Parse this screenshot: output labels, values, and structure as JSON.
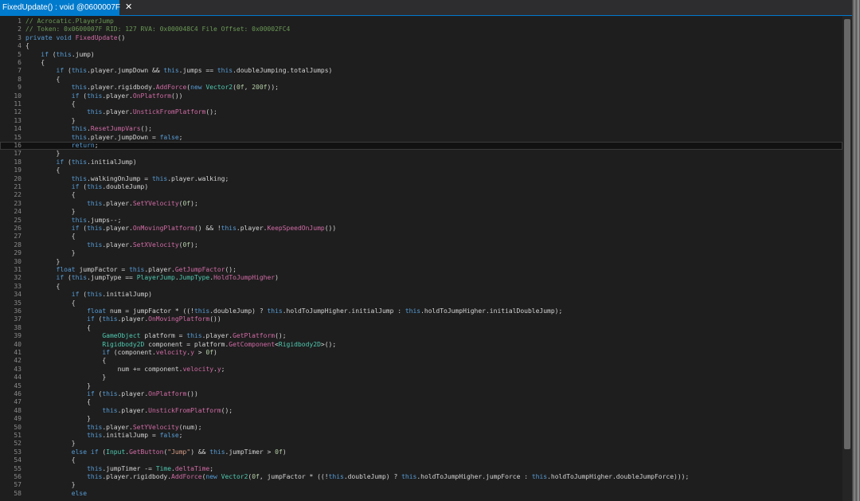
{
  "tab": {
    "title": "FixedUpdate() : void @0600007F",
    "close_glyph": "✕"
  },
  "colors": {
    "background": "#1e1e1e",
    "keyword": "#569cd6",
    "method": "#d16ba5",
    "type": "#4ec9b0",
    "comment": "#6a9955",
    "number": "#b5cea8",
    "string": "#d69d85",
    "text": "#d4d4d4",
    "line_number": "#8a8a8a",
    "tab_accent": "#007acc"
  },
  "current_line": 16,
  "lines": [
    [
      [
        "cm",
        "// Acrocatic.PlayerJump"
      ]
    ],
    [
      [
        "cm",
        "// Token: 0x0600007F RID: 127 RVA: 0x000048C4 File Offset: 0x00002FC4"
      ]
    ],
    [
      [
        "kw",
        "private"
      ],
      [
        "id",
        " "
      ],
      [
        "kw",
        "void"
      ],
      [
        "id",
        " "
      ],
      [
        "fn",
        "FixedUpdate"
      ],
      [
        "id",
        "()"
      ]
    ],
    [
      [
        "id",
        "{"
      ]
    ],
    [
      [
        "id",
        "    "
      ],
      [
        "kw",
        "if"
      ],
      [
        "id",
        " ("
      ],
      [
        "kw",
        "this"
      ],
      [
        "id",
        ".jump)"
      ]
    ],
    [
      [
        "id",
        "    {"
      ]
    ],
    [
      [
        "id",
        "        "
      ],
      [
        "kw",
        "if"
      ],
      [
        "id",
        " ("
      ],
      [
        "kw",
        "this"
      ],
      [
        "id",
        ".player.jumpDown && "
      ],
      [
        "kw",
        "this"
      ],
      [
        "id",
        ".jumps == "
      ],
      [
        "kw",
        "this"
      ],
      [
        "id",
        ".doubleJumping.totalJumps)"
      ]
    ],
    [
      [
        "id",
        "        {"
      ]
    ],
    [
      [
        "id",
        "            "
      ],
      [
        "kw",
        "this"
      ],
      [
        "id",
        ".player.rigidbody."
      ],
      [
        "fn",
        "AddForce"
      ],
      [
        "id",
        "("
      ],
      [
        "kw",
        "new"
      ],
      [
        "id",
        " "
      ],
      [
        "ty",
        "Vector2"
      ],
      [
        "id",
        "("
      ],
      [
        "nu",
        "0f"
      ],
      [
        "id",
        ", "
      ],
      [
        "nu",
        "200f"
      ],
      [
        "id",
        "));"
      ]
    ],
    [
      [
        "id",
        "            "
      ],
      [
        "kw",
        "if"
      ],
      [
        "id",
        " ("
      ],
      [
        "kw",
        "this"
      ],
      [
        "id",
        ".player."
      ],
      [
        "fn",
        "OnPlatform"
      ],
      [
        "id",
        "())"
      ]
    ],
    [
      [
        "id",
        "            {"
      ]
    ],
    [
      [
        "id",
        "                "
      ],
      [
        "kw",
        "this"
      ],
      [
        "id",
        ".player."
      ],
      [
        "fn",
        "UnstickFromPlatform"
      ],
      [
        "id",
        "();"
      ]
    ],
    [
      [
        "id",
        "            }"
      ]
    ],
    [
      [
        "id",
        "            "
      ],
      [
        "kw",
        "this"
      ],
      [
        "id",
        "."
      ],
      [
        "fn",
        "ResetJumpVars"
      ],
      [
        "id",
        "();"
      ]
    ],
    [
      [
        "id",
        "            "
      ],
      [
        "kw",
        "this"
      ],
      [
        "id",
        ".player.jumpDown = "
      ],
      [
        "kw",
        "false"
      ],
      [
        "id",
        ";"
      ]
    ],
    [
      [
        "id",
        "            "
      ],
      [
        "kw",
        "return"
      ],
      [
        "id",
        ";"
      ]
    ],
    [
      [
        "id",
        "        }"
      ]
    ],
    [
      [
        "id",
        "        "
      ],
      [
        "kw",
        "if"
      ],
      [
        "id",
        " ("
      ],
      [
        "kw",
        "this"
      ],
      [
        "id",
        ".initialJump)"
      ]
    ],
    [
      [
        "id",
        "        {"
      ]
    ],
    [
      [
        "id",
        "            "
      ],
      [
        "kw",
        "this"
      ],
      [
        "id",
        ".walkingOnJump = "
      ],
      [
        "kw",
        "this"
      ],
      [
        "id",
        ".player.walking;"
      ]
    ],
    [
      [
        "id",
        "            "
      ],
      [
        "kw",
        "if"
      ],
      [
        "id",
        " ("
      ],
      [
        "kw",
        "this"
      ],
      [
        "id",
        ".doubleJump)"
      ]
    ],
    [
      [
        "id",
        "            {"
      ]
    ],
    [
      [
        "id",
        "                "
      ],
      [
        "kw",
        "this"
      ],
      [
        "id",
        ".player."
      ],
      [
        "fn",
        "SetYVelocity"
      ],
      [
        "id",
        "("
      ],
      [
        "nu",
        "0f"
      ],
      [
        "id",
        ");"
      ]
    ],
    [
      [
        "id",
        "            }"
      ]
    ],
    [
      [
        "id",
        "            "
      ],
      [
        "kw",
        "this"
      ],
      [
        "id",
        ".jumps--;"
      ]
    ],
    [
      [
        "id",
        "            "
      ],
      [
        "kw",
        "if"
      ],
      [
        "id",
        " ("
      ],
      [
        "kw",
        "this"
      ],
      [
        "id",
        ".player."
      ],
      [
        "fn",
        "OnMovingPlatform"
      ],
      [
        "id",
        "() && !"
      ],
      [
        "kw",
        "this"
      ],
      [
        "id",
        ".player."
      ],
      [
        "fn",
        "KeepSpeedOnJump"
      ],
      [
        "id",
        "())"
      ]
    ],
    [
      [
        "id",
        "            {"
      ]
    ],
    [
      [
        "id",
        "                "
      ],
      [
        "kw",
        "this"
      ],
      [
        "id",
        ".player."
      ],
      [
        "fn",
        "SetXVelocity"
      ],
      [
        "id",
        "("
      ],
      [
        "nu",
        "0f"
      ],
      [
        "id",
        ");"
      ]
    ],
    [
      [
        "id",
        "            }"
      ]
    ],
    [
      [
        "id",
        "        }"
      ]
    ],
    [
      [
        "id",
        "        "
      ],
      [
        "kw",
        "float"
      ],
      [
        "id",
        " jumpFactor = "
      ],
      [
        "kw",
        "this"
      ],
      [
        "id",
        ".player."
      ],
      [
        "fn",
        "GetJumpFactor"
      ],
      [
        "id",
        "();"
      ]
    ],
    [
      [
        "id",
        "        "
      ],
      [
        "kw",
        "if"
      ],
      [
        "id",
        " ("
      ],
      [
        "kw",
        "this"
      ],
      [
        "id",
        ".jumpType == "
      ],
      [
        "ty",
        "PlayerJump"
      ],
      [
        "id",
        "."
      ],
      [
        "ty",
        "JumpType"
      ],
      [
        "id",
        "."
      ],
      [
        "fn",
        "HoldToJumpHigher"
      ],
      [
        "id",
        ")"
      ]
    ],
    [
      [
        "id",
        "        {"
      ]
    ],
    [
      [
        "id",
        "            "
      ],
      [
        "kw",
        "if"
      ],
      [
        "id",
        " ("
      ],
      [
        "kw",
        "this"
      ],
      [
        "id",
        ".initialJump)"
      ]
    ],
    [
      [
        "id",
        "            {"
      ]
    ],
    [
      [
        "id",
        "                "
      ],
      [
        "kw",
        "float"
      ],
      [
        "id",
        " num = jumpFactor * ((!"
      ],
      [
        "kw",
        "this"
      ],
      [
        "id",
        ".doubleJump) ? "
      ],
      [
        "kw",
        "this"
      ],
      [
        "id",
        ".holdToJumpHigher.initialJump : "
      ],
      [
        "kw",
        "this"
      ],
      [
        "id",
        ".holdToJumpHigher.initialDoubleJump);"
      ]
    ],
    [
      [
        "id",
        "                "
      ],
      [
        "kw",
        "if"
      ],
      [
        "id",
        " ("
      ],
      [
        "kw",
        "this"
      ],
      [
        "id",
        ".player."
      ],
      [
        "fn",
        "OnMovingPlatform"
      ],
      [
        "id",
        "())"
      ]
    ],
    [
      [
        "id",
        "                {"
      ]
    ],
    [
      [
        "id",
        "                    "
      ],
      [
        "ty",
        "GameObject"
      ],
      [
        "id",
        " platform = "
      ],
      [
        "kw",
        "this"
      ],
      [
        "id",
        ".player."
      ],
      [
        "fn",
        "GetPlatform"
      ],
      [
        "id",
        "();"
      ]
    ],
    [
      [
        "id",
        "                    "
      ],
      [
        "ty",
        "Rigidbody2D"
      ],
      [
        "id",
        " component = platform."
      ],
      [
        "fn",
        "GetComponent"
      ],
      [
        "id",
        "<"
      ],
      [
        "ty",
        "Rigidbody2D"
      ],
      [
        "id",
        ">();"
      ]
    ],
    [
      [
        "id",
        "                    "
      ],
      [
        "kw",
        "if"
      ],
      [
        "id",
        " (component."
      ],
      [
        "fn",
        "velocity"
      ],
      [
        "id",
        "."
      ],
      [
        "fn",
        "y"
      ],
      [
        "id",
        " > "
      ],
      [
        "nu",
        "0f"
      ],
      [
        "id",
        ")"
      ]
    ],
    [
      [
        "id",
        "                    {"
      ]
    ],
    [
      [
        "id",
        "                        num += component."
      ],
      [
        "fn",
        "velocity"
      ],
      [
        "id",
        "."
      ],
      [
        "fn",
        "y"
      ],
      [
        "id",
        ";"
      ]
    ],
    [
      [
        "id",
        "                    }"
      ]
    ],
    [
      [
        "id",
        "                }"
      ]
    ],
    [
      [
        "id",
        "                "
      ],
      [
        "kw",
        "if"
      ],
      [
        "id",
        " ("
      ],
      [
        "kw",
        "this"
      ],
      [
        "id",
        ".player."
      ],
      [
        "fn",
        "OnPlatform"
      ],
      [
        "id",
        "())"
      ]
    ],
    [
      [
        "id",
        "                {"
      ]
    ],
    [
      [
        "id",
        "                    "
      ],
      [
        "kw",
        "this"
      ],
      [
        "id",
        ".player."
      ],
      [
        "fn",
        "UnstickFromPlatform"
      ],
      [
        "id",
        "();"
      ]
    ],
    [
      [
        "id",
        "                }"
      ]
    ],
    [
      [
        "id",
        "                "
      ],
      [
        "kw",
        "this"
      ],
      [
        "id",
        ".player."
      ],
      [
        "fn",
        "SetYVelocity"
      ],
      [
        "id",
        "(num);"
      ]
    ],
    [
      [
        "id",
        "                "
      ],
      [
        "kw",
        "this"
      ],
      [
        "id",
        ".initialJump = "
      ],
      [
        "kw",
        "false"
      ],
      [
        "id",
        ";"
      ]
    ],
    [
      [
        "id",
        "            }"
      ]
    ],
    [
      [
        "id",
        "            "
      ],
      [
        "kw",
        "else"
      ],
      [
        "id",
        " "
      ],
      [
        "kw",
        "if"
      ],
      [
        "id",
        " ("
      ],
      [
        "ty",
        "Input"
      ],
      [
        "id",
        "."
      ],
      [
        "fn",
        "GetButton"
      ],
      [
        "id",
        "("
      ],
      [
        "st",
        "\"Jump\""
      ],
      [
        "id",
        ") && "
      ],
      [
        "kw",
        "this"
      ],
      [
        "id",
        ".jumpTimer > "
      ],
      [
        "nu",
        "0f"
      ],
      [
        "id",
        ")"
      ]
    ],
    [
      [
        "id",
        "            {"
      ]
    ],
    [
      [
        "id",
        "                "
      ],
      [
        "kw",
        "this"
      ],
      [
        "id",
        ".jumpTimer -= "
      ],
      [
        "ty",
        "Time"
      ],
      [
        "id",
        "."
      ],
      [
        "fn",
        "deltaTime"
      ],
      [
        "id",
        ";"
      ]
    ],
    [
      [
        "id",
        "                "
      ],
      [
        "kw",
        "this"
      ],
      [
        "id",
        ".player.rigidbody."
      ],
      [
        "fn",
        "AddForce"
      ],
      [
        "id",
        "("
      ],
      [
        "kw",
        "new"
      ],
      [
        "id",
        " "
      ],
      [
        "ty",
        "Vector2"
      ],
      [
        "id",
        "("
      ],
      [
        "nu",
        "0f"
      ],
      [
        "id",
        ", jumpFactor * ((!"
      ],
      [
        "kw",
        "this"
      ],
      [
        "id",
        ".doubleJump) ? "
      ],
      [
        "kw",
        "this"
      ],
      [
        "id",
        ".holdToJumpHigher.jumpForce : "
      ],
      [
        "kw",
        "this"
      ],
      [
        "id",
        ".holdToJumpHigher.doubleJumpForce)));"
      ]
    ],
    [
      [
        "id",
        "            }"
      ]
    ],
    [
      [
        "id",
        "            "
      ],
      [
        "kw",
        "else"
      ]
    ]
  ]
}
